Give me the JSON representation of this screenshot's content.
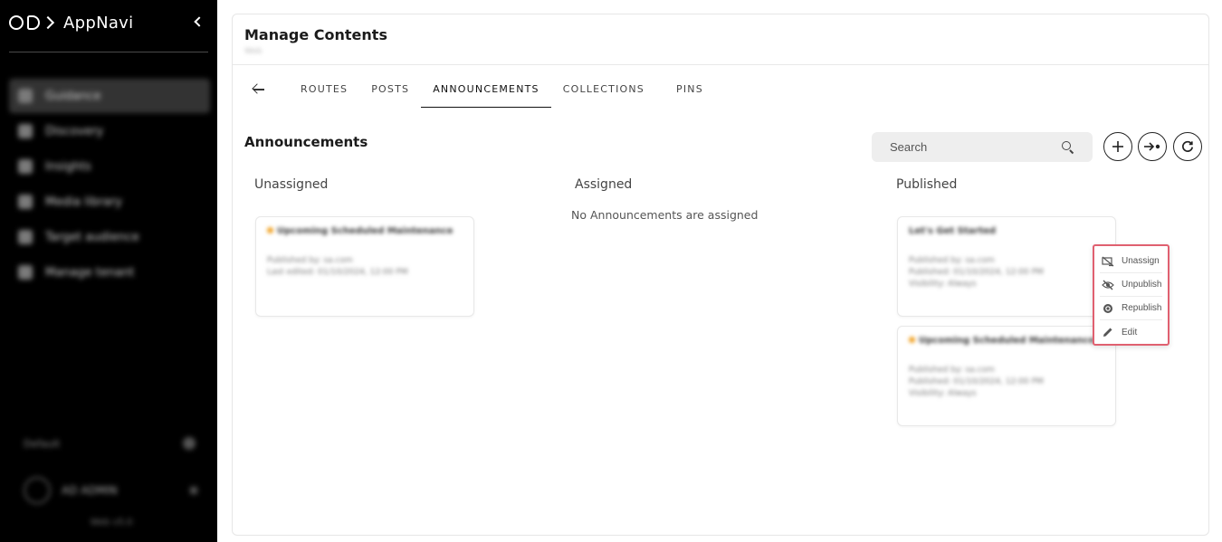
{
  "app": {
    "name": "AppNavi"
  },
  "sidebar": {
    "items": [
      {
        "label": "Guidance",
        "active": true
      },
      {
        "label": "Discovery",
        "active": false
      },
      {
        "label": "Insights",
        "active": false
      },
      {
        "label": "Media library",
        "active": false
      },
      {
        "label": "Target audience",
        "active": false
      },
      {
        "label": "Manage tenant",
        "active": false
      }
    ],
    "org_label": "Default",
    "user_name": "AD ADMIN",
    "version": "Web v5.0"
  },
  "header": {
    "title": "Manage Contents",
    "subtitle": "Web"
  },
  "tabs": [
    {
      "label": "ROUTES",
      "active": false
    },
    {
      "label": "POSTS",
      "active": false
    },
    {
      "label": "ANNOUNCEMENTS",
      "active": true
    },
    {
      "label": "COLLECTIONS",
      "active": false
    },
    {
      "label": "PINS",
      "active": false
    }
  ],
  "section": {
    "title": "Announcements"
  },
  "search": {
    "placeholder": "Search"
  },
  "columns": {
    "unassigned": {
      "title": "Unassigned",
      "cards": [
        {
          "title": "Upcoming Scheduled Maintenance",
          "line1": "Published by: sa.com",
          "line2": "Last edited: 01/10/2024, 12:00 PM"
        }
      ]
    },
    "assigned": {
      "title": "Assigned",
      "empty_message": "No Announcements are assigned"
    },
    "published": {
      "title": "Published",
      "cards": [
        {
          "title": "Let's Get Started",
          "line1": "Published by: sa.com",
          "line2": "Published: 01/10/2024, 12:00 PM",
          "line3": "Visibility: Always"
        },
        {
          "title": "Upcoming Scheduled Maintenance",
          "line1": "Published by: sa.com",
          "line2": "Published: 01/10/2024, 12:00 PM",
          "line3": "Visibility: Always"
        }
      ]
    }
  },
  "context_menu": {
    "items": [
      {
        "label": "Unassign",
        "icon": "unassign-icon"
      },
      {
        "label": "Unpublish",
        "icon": "eye-off-icon"
      },
      {
        "label": "Republish",
        "icon": "republish-icon"
      },
      {
        "label": "Edit",
        "icon": "pencil-icon"
      }
    ]
  },
  "colors": {
    "sidebar_bg": "#000000",
    "menu_border": "#e06070",
    "search_bg": "#eeeeee"
  }
}
